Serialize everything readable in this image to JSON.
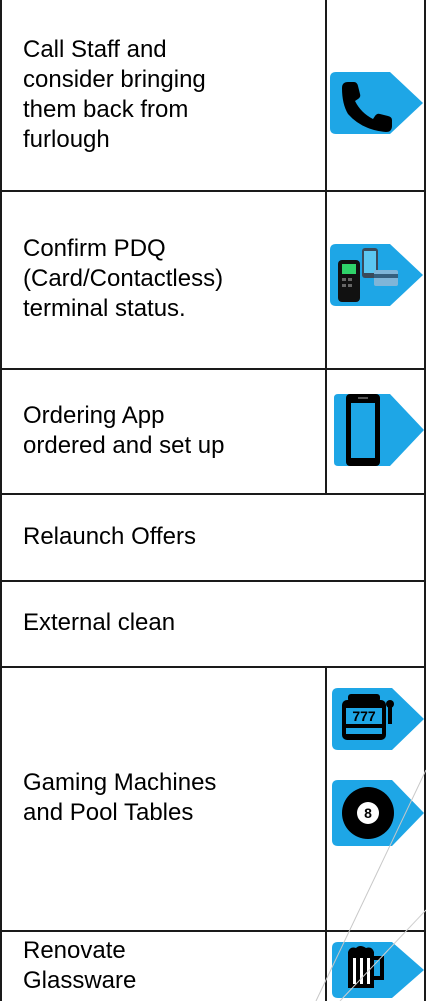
{
  "rows": [
    {
      "text": "Call Staff and\nconsider bringing\nthem back from\nfurlough",
      "icons": [
        "phone-icon"
      ]
    },
    {
      "text": "Confirm  PDQ\n(Card/Contactless)\nterminal status.",
      "icons": [
        "card-terminal-icon"
      ]
    },
    {
      "text": "Ordering App\nordered and set up",
      "icons": [
        "smartphone-icon"
      ]
    },
    {
      "text": "Relaunch Offers",
      "icons": []
    },
    {
      "text": "External clean",
      "icons": []
    },
    {
      "text": "Gaming Machines\nand Pool Tables",
      "icons": [
        "slot-machine-icon",
        "pool-ball-icon"
      ]
    },
    {
      "text": "Renovate\nGlassware",
      "icons": [
        "beer-glass-icon"
      ]
    }
  ],
  "icon_colors": {
    "tag": "#1ea6e6",
    "glyph": "#000000"
  },
  "slot_reels": "777",
  "pool_ball_number": "8"
}
